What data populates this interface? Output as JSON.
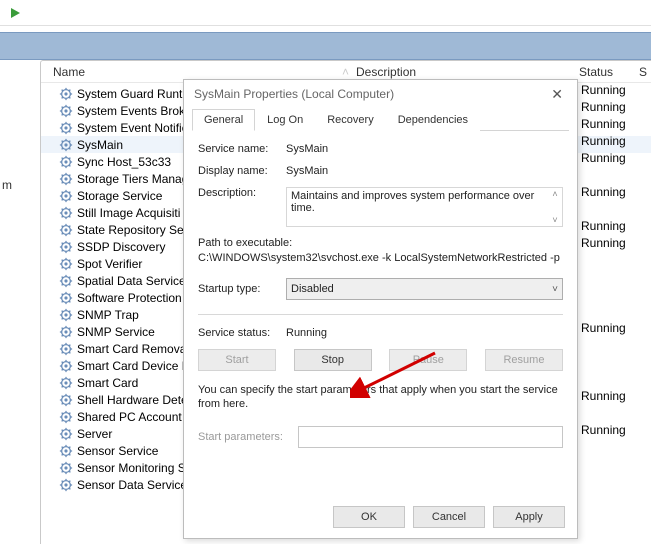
{
  "toolbar": {
    "play_icon": "play"
  },
  "columns": {
    "name": "Name",
    "desc": "Description",
    "status": "Status",
    "s": "S"
  },
  "left_fragment": "m",
  "services": [
    {
      "label": "System Guard Runti",
      "status": "Running",
      "selected": false
    },
    {
      "label": "System Events Broke",
      "status": "Running",
      "selected": false
    },
    {
      "label": "System Event Notific",
      "status": "Running",
      "selected": false
    },
    {
      "label": "SysMain",
      "status": "Running",
      "selected": true
    },
    {
      "label": "Sync Host_53c33",
      "status": "Running",
      "selected": false
    },
    {
      "label": "Storage Tiers Manag",
      "status": "",
      "selected": false
    },
    {
      "label": "Storage Service",
      "status": "Running",
      "selected": false
    },
    {
      "label": "Still Image Acquisiti",
      "status": "",
      "selected": false
    },
    {
      "label": "State Repository Ser",
      "status": "Running",
      "selected": false
    },
    {
      "label": "SSDP Discovery",
      "status": "Running",
      "selected": false
    },
    {
      "label": "Spot Verifier",
      "status": "",
      "selected": false
    },
    {
      "label": "Spatial Data Service",
      "status": "",
      "selected": false
    },
    {
      "label": "Software Protection",
      "status": "",
      "selected": false
    },
    {
      "label": "SNMP Trap",
      "status": "",
      "selected": false
    },
    {
      "label": "SNMP Service",
      "status": "Running",
      "selected": false
    },
    {
      "label": "Smart Card Remova",
      "status": "",
      "selected": false
    },
    {
      "label": "Smart Card Device E",
      "status": "",
      "selected": false
    },
    {
      "label": "Smart Card",
      "status": "",
      "selected": false
    },
    {
      "label": "Shell Hardware Dete",
      "status": "Running",
      "selected": false
    },
    {
      "label": "Shared PC Account",
      "status": "",
      "selected": false
    },
    {
      "label": "Server",
      "status": "Running",
      "selected": false
    },
    {
      "label": "Sensor Service",
      "status": "",
      "selected": false
    },
    {
      "label": "Sensor Monitoring S",
      "status": "",
      "selected": false
    },
    {
      "label": "Sensor Data Service",
      "status": "",
      "selected": false
    }
  ],
  "dialog": {
    "title": "SysMain Properties (Local Computer)",
    "tabs": {
      "general": "General",
      "logon": "Log On",
      "recovery": "Recovery",
      "deps": "Dependencies"
    },
    "service_name_lbl": "Service name:",
    "service_name_val": "SysMain",
    "display_name_lbl": "Display name:",
    "display_name_val": "SysMain",
    "description_lbl": "Description:",
    "description_val": "Maintains and improves system performance over time.",
    "path_lbl": "Path to executable:",
    "path_val": "C:\\WINDOWS\\system32\\svchost.exe -k LocalSystemNetworkRestricted -p",
    "startup_lbl": "Startup type:",
    "startup_val": "Disabled",
    "status_lbl": "Service status:",
    "status_val": "Running",
    "btn_start": "Start",
    "btn_stop": "Stop",
    "btn_pause": "Pause",
    "btn_resume": "Resume",
    "hint": "You can specify the start parameters that apply when you start the service from here.",
    "params_lbl": "Start parameters:",
    "ok": "OK",
    "cancel": "Cancel",
    "apply": "Apply"
  }
}
